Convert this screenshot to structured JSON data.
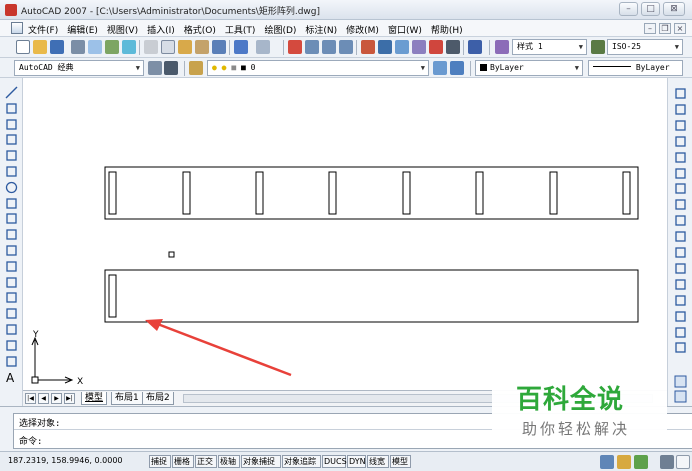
{
  "window": {
    "title": "AutoCAD 2007 - [C:\\Users\\Administrator\\Documents\\矩形阵列.dwg]",
    "minimize_label": "–",
    "maximize_label": "□",
    "close_label": "⊠"
  },
  "menu": {
    "items": [
      "文件(F)",
      "编辑(E)",
      "视图(V)",
      "插入(I)",
      "格式(O)",
      "工具(T)",
      "绘图(D)",
      "标注(N)",
      "修改(M)",
      "窗口(W)",
      "帮助(H)"
    ],
    "mdi_minimize": "–",
    "mdi_restore": "❐",
    "mdi_close": "×"
  },
  "toolbar1": {
    "text_style": "样式 1",
    "dim_style": "ISO-25"
  },
  "toolbar2": {
    "workspace": "AutoCAD 经典",
    "layer": "0",
    "color": "ByLayer",
    "linetype": "ByLayer"
  },
  "canvas": {
    "ucs_x": "X",
    "ucs_y": "Y"
  },
  "tabs": {
    "items": [
      "模型",
      "布局1",
      "布局2"
    ],
    "active": "模型"
  },
  "command": {
    "history": "选择对象:",
    "prompt": "命令:"
  },
  "status": {
    "coordinates": "187.2319, 158.9946, 0.0000",
    "toggles": [
      "捕捉",
      "栅格",
      "正交",
      "极轴",
      "对象捕捉",
      "对象追踪",
      "DUCS",
      "DYN",
      "线宽",
      "模型"
    ]
  },
  "watermark": {
    "brand": "百科全说",
    "tagline": "助你轻松解决"
  },
  "colors": {
    "annotation_arrow": "#e8413a",
    "watermark_green": "#2ea83a"
  }
}
